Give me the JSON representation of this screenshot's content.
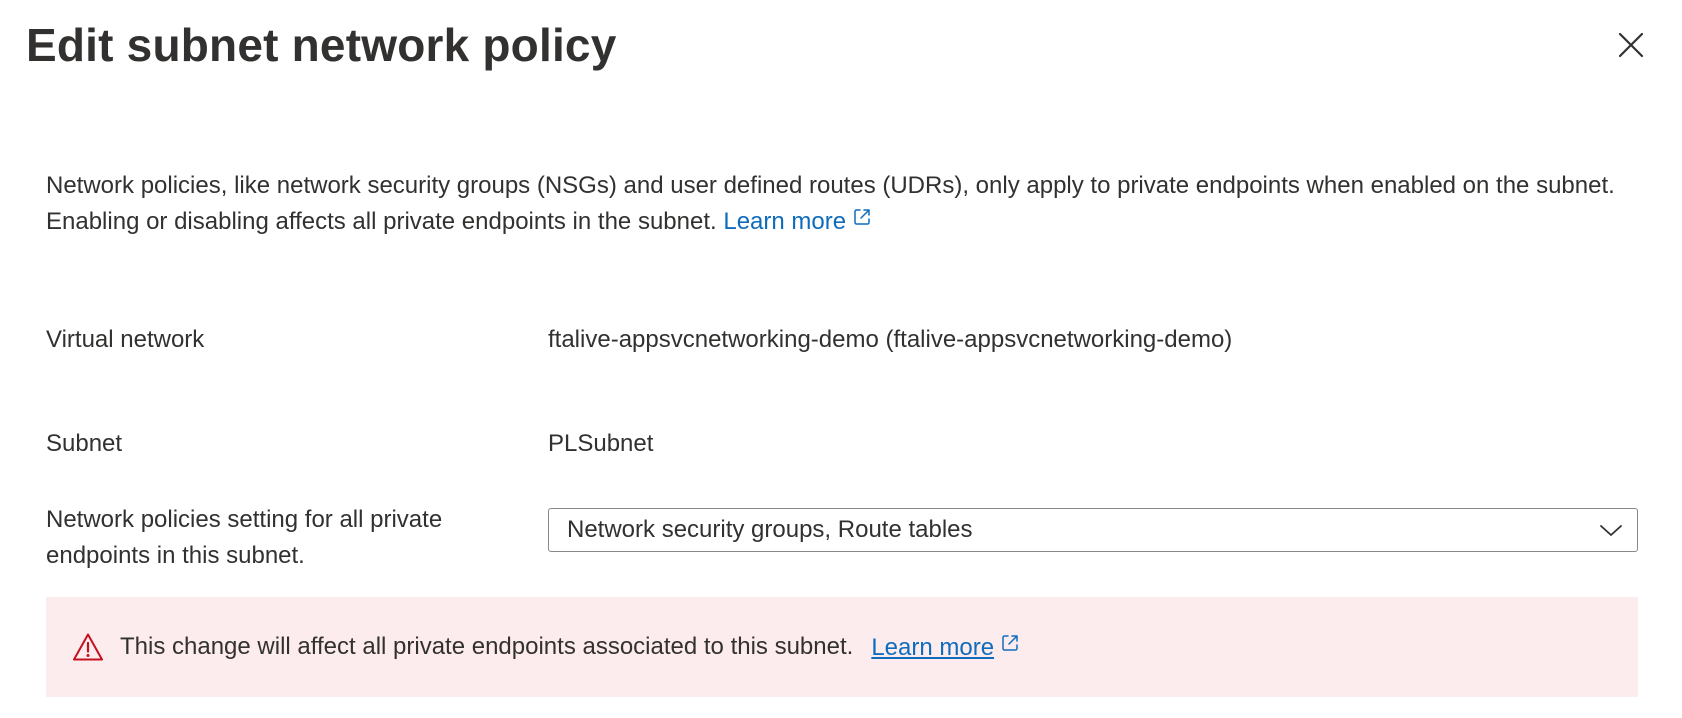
{
  "panel": {
    "title": "Edit subnet network policy",
    "close_label": "Close"
  },
  "description": {
    "text": "Network policies, like network security groups (NSGs) and user defined routes (UDRs), only apply to private endpoints when enabled on the subnet. Enabling or disabling affects all private endpoints in the subnet.",
    "link_label": "Learn more"
  },
  "fields": {
    "virtual_network": {
      "label": "Virtual network",
      "value": "ftalive-appsvcnetworking-demo (ftalive-appsvcnetworking-demo)"
    },
    "subnet": {
      "label": "Subnet",
      "value": "PLSubnet"
    },
    "network_policies": {
      "label_line1": "Network policies setting for all private",
      "label_line2": "endpoints in this subnet.",
      "selected": "Network security groups, Route tables"
    }
  },
  "warning": {
    "text": "This change will affect all private endpoints associated to this subnet.",
    "link_label": "Learn more"
  },
  "colors": {
    "link": "#0f6cbd",
    "warning_bg": "#fdeced",
    "warning_icon": "#c50f1f",
    "text": "#323130",
    "border": "#8a8886"
  },
  "icons": {
    "close": "close-icon",
    "external_link": "external-link-icon",
    "dropdown": "chevron-down-icon",
    "warning": "warning-icon"
  }
}
